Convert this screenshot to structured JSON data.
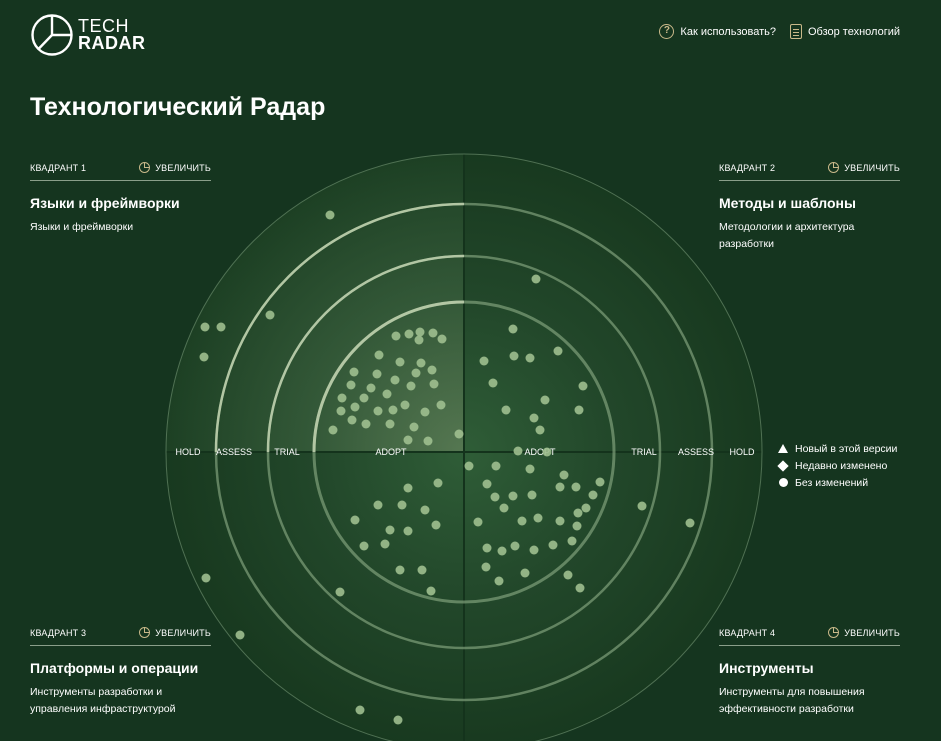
{
  "header": {
    "logo_line1": "TECH",
    "logo_line2": "RADAR",
    "links": [
      {
        "label": "Как использовать?",
        "icon": "question-icon"
      },
      {
        "label": "Обзор технологий",
        "icon": "document-icon"
      }
    ]
  },
  "page_title": "Технологический Радар",
  "quadrants": [
    {
      "label": "КВАДРАНТ 1",
      "zoom_label": "УВЕЛИЧИТЬ",
      "title": "Языки и фреймворки",
      "desc": "Языки и фреймворки"
    },
    {
      "label": "КВАДРАНТ 2",
      "zoom_label": "УВЕЛИЧИТЬ",
      "title": "Методы и шаблоны",
      "desc": "Методологии и архитектура разработки"
    },
    {
      "label": "КВАДРАНТ 3",
      "zoom_label": "УВЕЛИЧИТЬ",
      "title": "Платформы и операции",
      "desc": "Инструменты разработки и управления инфраструктурой"
    },
    {
      "label": "КВАДРАНТ 4",
      "zoom_label": "УВЕЛИЧИТЬ",
      "title": "Инструменты",
      "desc": "Инструменты для повышения эффективности разработки"
    }
  ],
  "rings": [
    "ADOPT",
    "TRIAL",
    "ASSESS",
    "HOLD"
  ],
  "legend": [
    {
      "label": "Новый в этой версии",
      "shape": "triangle"
    },
    {
      "label": "Недавно изменено",
      "shape": "diamond"
    },
    {
      "label": "Без изменений",
      "shape": "circle"
    }
  ],
  "colors": {
    "background": "#15351f",
    "accent": "#c9b98a",
    "blip": "#9fbf8f"
  }
}
